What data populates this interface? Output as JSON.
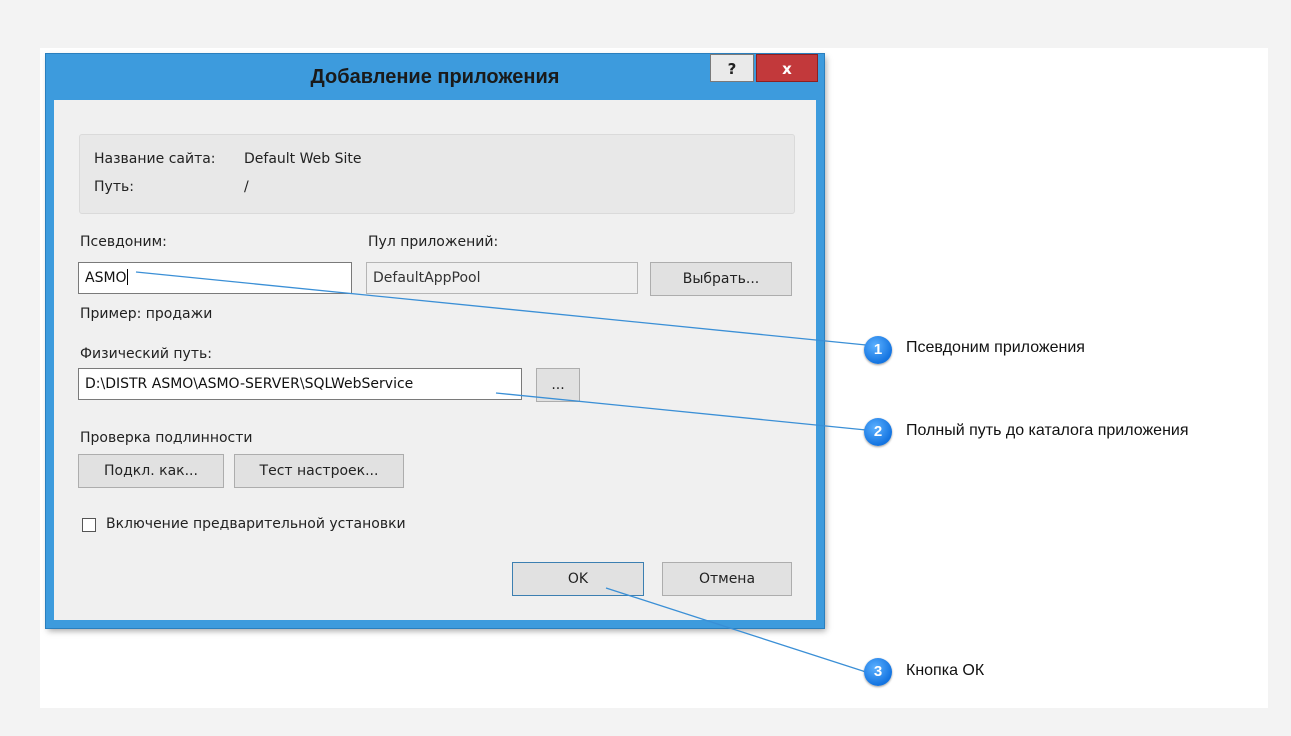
{
  "dialog": {
    "title": "Добавление приложения",
    "help_label": "?",
    "close_label": "x",
    "site_name_label": "Название сайта:",
    "site_name_value": "Default Web Site",
    "path_label": "Путь:",
    "path_value": "/",
    "alias_label": "Псевдоним:",
    "alias_value": "ASMO",
    "alias_example": "Пример: продажи",
    "app_pool_label": "Пул приложений:",
    "app_pool_value": "DefaultAppPool",
    "select_button": "Выбрать...",
    "physical_path_label": "Физический путь:",
    "physical_path_value": "D:\\DISTR ASMO\\ASMO-SERVER\\SQLWebService",
    "browse_button": "...",
    "auth_label": "Проверка подлинности",
    "connect_as_button": "Подкл. как...",
    "test_settings_button": "Тест настроек...",
    "preload_checkbox_label": "Включение предварительной установки",
    "preload_checked": false,
    "ok_button": "OK",
    "cancel_button": "Отмена"
  },
  "callouts": [
    {
      "number": "1",
      "text": "Псевдоним приложения"
    },
    {
      "number": "2",
      "text": "Полный путь до каталога приложения"
    },
    {
      "number": "3",
      "text": "Кнопка ОК"
    }
  ],
  "colors": {
    "titlebar": "#3d9bdd",
    "close_button": "#c2393b",
    "callout_badge": "#1474e0",
    "callout_line": "#3a8fd6"
  }
}
